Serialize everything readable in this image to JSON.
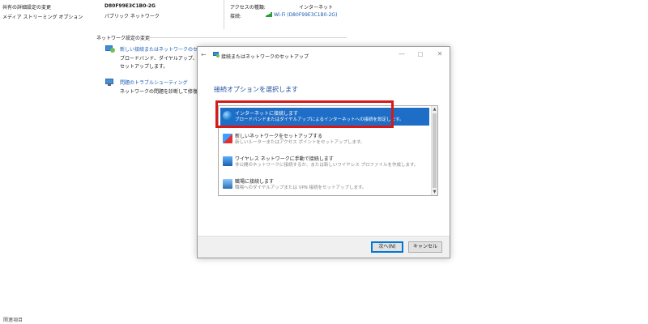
{
  "background": {
    "left_links": [
      "共有の詳細設定の変更",
      "メディア ストリーミング オプション"
    ],
    "network_name": "D80F99E3C1B0-2G",
    "network_type": "パブリック ネットワーク",
    "access_type_label": "アクセスの種類:",
    "access_type_value": "インターネット",
    "connection_label": "接続:",
    "connection_value": "Wi-Fi (D80F99E3C1B0-2G)",
    "change_settings_heading": "ネットワーク設定の変更",
    "new_connection_link": "新しい接続またはネットワークのセットアップ",
    "new_connection_desc_1": "ブロードバンド、ダイヤルアップ、または V",
    "new_connection_desc_2": "セットアップします。",
    "troubleshoot_link": "問題のトラブルシューティング",
    "troubleshoot_desc": "ネットワークの問題を診断して修復します",
    "related_items": "関連項目"
  },
  "dialog": {
    "title": "接続またはネットワークのセットアップ",
    "heading": "接続オプションを選択します",
    "options": [
      {
        "title": "インターネットに接続します",
        "desc": "ブロードバンドまたはダイヤルアップによるインターネットへの接続を設定します。",
        "icon": "globe-icon"
      },
      {
        "title": "新しいネットワークをセットアップする",
        "desc": "新しいルーターまたはアクセス ポイントをセットアップします。",
        "icon": "network-icon"
      },
      {
        "title": "ワイヤレス ネットワークに手動で接続します",
        "desc": "非公開のネットワークに接続するか、または新しいワイヤレス プロファイルを作成します。",
        "icon": "wireless-icon"
      },
      {
        "title": "職場に接続します",
        "desc": "職場へのダイヤルアップまたは VPN 接続をセットアップします。",
        "icon": "vpn-icon"
      }
    ],
    "next_button": "次へ(N)",
    "cancel_button": "キャンセル"
  },
  "colors": {
    "accent": "#1e6dc6",
    "link": "#1a5fb4",
    "highlight_border": "#d61a1a"
  }
}
